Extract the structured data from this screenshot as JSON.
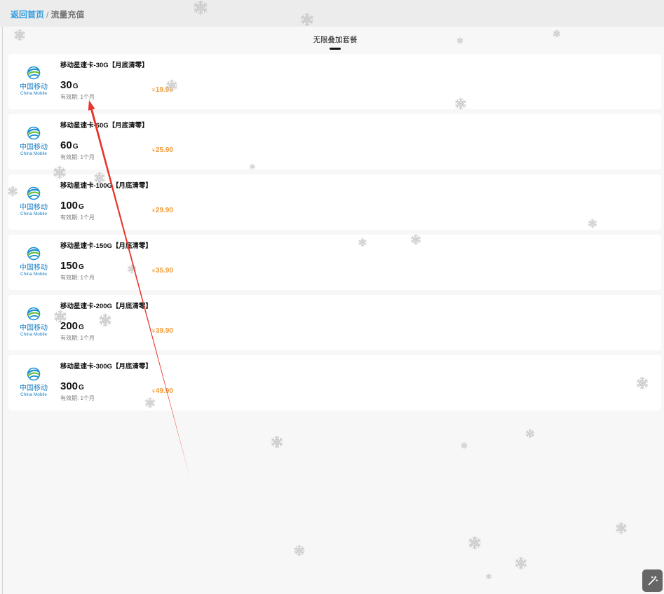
{
  "header": {
    "back_link": "返回首页",
    "separator": "/",
    "page_title": "流量充值"
  },
  "tabs": [
    {
      "label": "无限叠加套餐",
      "active": true
    }
  ],
  "carrier_logo": {
    "name_cn": "中国移动",
    "name_en": "China Mobile",
    "icon": "china-mobile-logo-icon"
  },
  "packages": [
    {
      "title": "移动星速卡-30G【月底清零】",
      "amount": "30",
      "unit": "G",
      "validity": "有效期: 1个月",
      "currency": "¥",
      "price": "19.90"
    },
    {
      "title": "移动星速卡-60G【月底清零】",
      "amount": "60",
      "unit": "G",
      "validity": "有效期: 1个月",
      "currency": "¥",
      "price": "25.90"
    },
    {
      "title": "移动星速卡-100G【月底清零】",
      "amount": "100",
      "unit": "G",
      "validity": "有效期: 1个月",
      "currency": "¥",
      "price": "29.90"
    },
    {
      "title": "移动星速卡-150G【月底清零】",
      "amount": "150",
      "unit": "G",
      "validity": "有效期: 1个月",
      "currency": "¥",
      "price": "35.90"
    },
    {
      "title": "移动星速卡-200G【月底清零】",
      "amount": "200",
      "unit": "G",
      "validity": "有效期: 1个月",
      "currency": "¥",
      "price": "39.90"
    },
    {
      "title": "移动星速卡-300G【月底清零】",
      "amount": "300",
      "unit": "G",
      "validity": "有效期: 1个月",
      "currency": "¥",
      "price": "49.90"
    }
  ],
  "icons": {
    "decoration": "snowflake-icon",
    "floating_button": "magic-wand-icon"
  },
  "colors": {
    "accent_blue": "#2f9be0",
    "page_title_gray": "#777777",
    "price_orange": "#f29b38",
    "logo_blue": "#1a7fc6",
    "logo_green": "#6cbf3e",
    "annotation_red": "#e8352c"
  }
}
